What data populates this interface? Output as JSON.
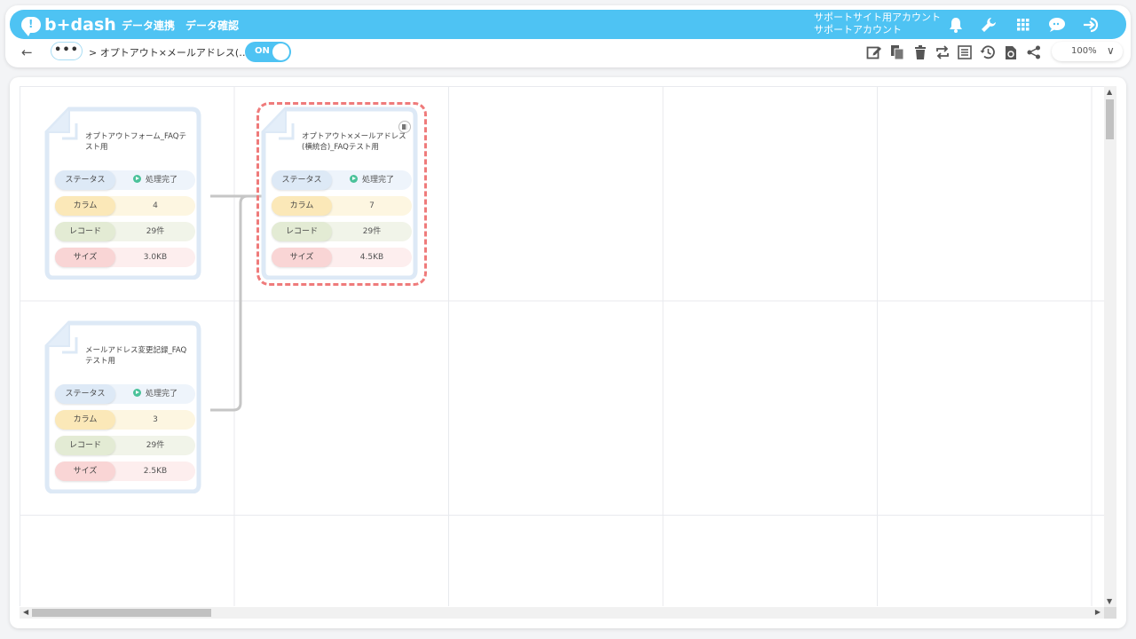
{
  "app": {
    "logo_text": "b+dash",
    "nav": [
      "データ連携",
      "データ確認"
    ],
    "account_line1": "サポートサイト用アカウント",
    "account_line2": "サポートアカウント",
    "top_icons": [
      "bell-icon",
      "wrench-icon",
      "grid-icon",
      "chat-icon",
      "logout-icon"
    ]
  },
  "toolbar": {
    "back": "←",
    "more": "•••",
    "breadcrumb": "> オプトアウト×メールアドレス(…",
    "toggle_label": "ON",
    "icons": [
      "edit-icon",
      "copy-icon",
      "delete-icon",
      "swap-icon",
      "table-icon",
      "history-icon",
      "refresh-file-icon",
      "share-icon"
    ],
    "zoom": "100%",
    "zoom_caret": "∨"
  },
  "row_labels": {
    "status": "ステータス",
    "column": "カラム",
    "record": "レコード",
    "size": "サイズ"
  },
  "cards": [
    {
      "title": "オプトアウトフォーム_FAQテスト用",
      "status": "処理完了",
      "columns": "4",
      "records": "29件",
      "size": "3.0KB"
    },
    {
      "title": "メールアドレス変更記録_FAQテスト用",
      "status": "処理完了",
      "columns": "3",
      "records": "29件",
      "size": "2.5KB"
    },
    {
      "title": "オプトアウト×メールアドレス(横統合)_FAQテスト用",
      "status": "処理完了",
      "columns": "7",
      "records": "29件",
      "size": "4.5KB"
    }
  ],
  "colors": {
    "brand": "#4ec3f3",
    "selection": "#ef7b7b",
    "status_ok": "#4bc29a"
  }
}
